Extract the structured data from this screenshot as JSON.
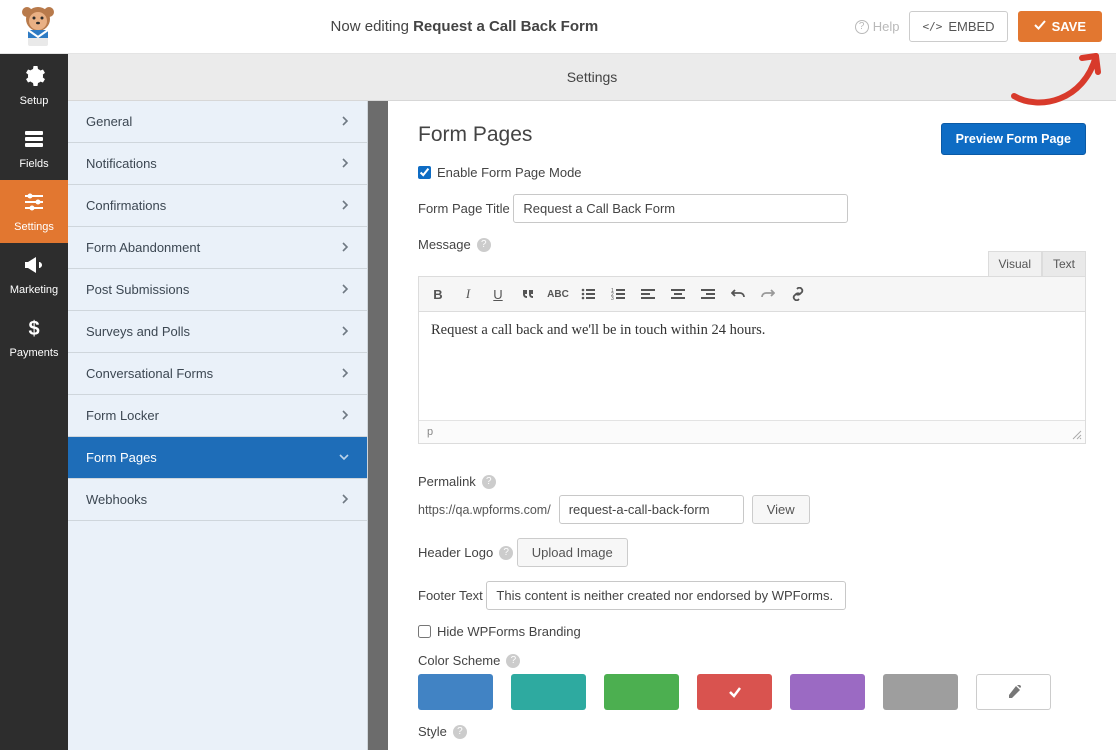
{
  "header": {
    "prefix": "Now editing ",
    "form_name": "Request a Call Back Form",
    "help_label": "Help",
    "embed_label": "EMBED",
    "save_label": "SAVE"
  },
  "nav": {
    "items": [
      {
        "key": "setup",
        "label": "Setup"
      },
      {
        "key": "fields",
        "label": "Fields"
      },
      {
        "key": "settings",
        "label": "Settings",
        "active": true
      },
      {
        "key": "marketing",
        "label": "Marketing"
      },
      {
        "key": "payments",
        "label": "Payments"
      }
    ]
  },
  "panel": {
    "title": "Settings"
  },
  "settings_menu": {
    "items": [
      {
        "label": "General"
      },
      {
        "label": "Notifications"
      },
      {
        "label": "Confirmations"
      },
      {
        "label": "Form Abandonment"
      },
      {
        "label": "Post Submissions"
      },
      {
        "label": "Surveys and Polls"
      },
      {
        "label": "Conversational Forms"
      },
      {
        "label": "Form Locker"
      },
      {
        "label": "Form Pages",
        "active": true
      },
      {
        "label": "Webhooks"
      }
    ]
  },
  "form_pages": {
    "title": "Form Pages",
    "preview_btn": "Preview Form Page",
    "enable_checkbox_label": "Enable Form Page Mode",
    "enable_checked": true,
    "page_title_label": "Form Page Title",
    "page_title_value": "Request a Call Back Form",
    "message_label": "Message",
    "editor": {
      "tab_visual": "Visual",
      "tab_text": "Text",
      "body": "Request a call back and we'll be in touch within 24 hours.",
      "status": "p"
    },
    "permalink_label": "Permalink",
    "permalink_prefix": "https://qa.wpforms.com/",
    "permalink_slug": "request-a-call-back-form",
    "permalink_view": "View",
    "header_logo_label": "Header Logo",
    "upload_image_btn": "Upload Image",
    "footer_text_label": "Footer Text",
    "footer_text_value": "This content is neither created nor endorsed by WPForms.",
    "hide_branding_label": "Hide WPForms Branding",
    "hide_branding_checked": false,
    "color_scheme_label": "Color Scheme",
    "colors": [
      "#4183c4",
      "#2eaaa0",
      "#4caf50",
      "#d9534f",
      "#9b6ac3",
      "#9e9e9e"
    ],
    "selected_color_index": 3,
    "style_label": "Style"
  }
}
